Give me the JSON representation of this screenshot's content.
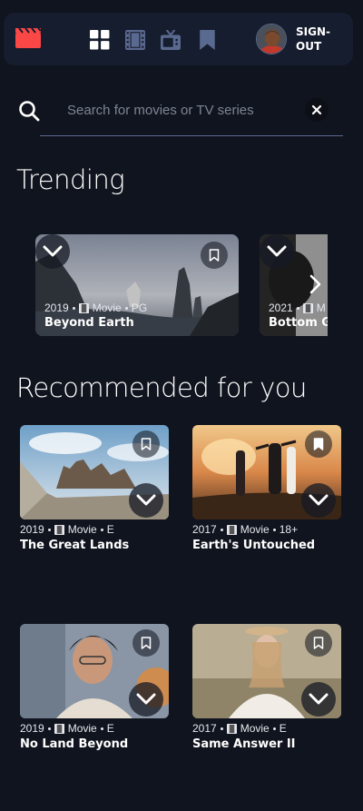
{
  "nav": {
    "logo_icon": "clapperboard-icon",
    "icons": [
      "home-grid-icon",
      "movies-film-icon",
      "tv-series-icon",
      "bookmark-icon"
    ],
    "signout_label": "SIGN-OUT",
    "colors": {
      "background": "#161d2f",
      "logo": "#fc4747",
      "icon_active": "#ffffff",
      "icon_inactive": "#5a698f"
    }
  },
  "search": {
    "placeholder": "Search for movies or TV series",
    "value": ""
  },
  "trending": {
    "heading": "Trending",
    "items": [
      {
        "year": "2019",
        "category": "Movie",
        "rating": "PG",
        "title": "Beyond Earth"
      },
      {
        "year": "2021",
        "category": "M",
        "rating": "",
        "title": "Bottom Ge"
      }
    ]
  },
  "recommended": {
    "heading": "Recommended for you",
    "items": [
      {
        "year": "2019",
        "category": "Movie",
        "rating": "E",
        "title": "The Great Lands"
      },
      {
        "year": "2017",
        "category": "Movie",
        "rating": "18+",
        "title": "Earth's Untouched"
      },
      {
        "year": "2019",
        "category": "Movie",
        "rating": "E",
        "title": "No Land Beyond"
      },
      {
        "year": "2017",
        "category": "Movie",
        "rating": "E",
        "title": "Same Answer II"
      }
    ]
  },
  "colors": {
    "page_background": "#10141e",
    "divider": "#5a698f",
    "placeholder": "#7d8594"
  }
}
